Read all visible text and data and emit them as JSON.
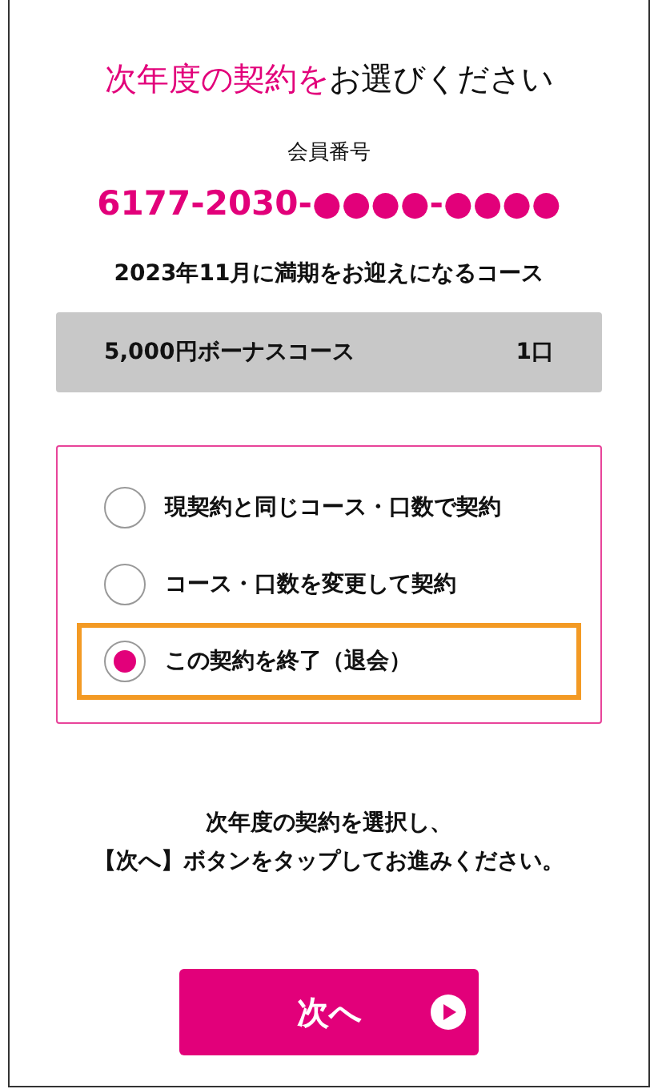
{
  "title": {
    "highlight": "次年度の契約を",
    "rest": "お選びください"
  },
  "member": {
    "label": "会員番号",
    "number": "6177-2030-●●●●-●●●●"
  },
  "course_heading": "2023年11月に満期をお迎えになるコース",
  "course": {
    "name": "5,000円ボーナスコース",
    "units": "1口"
  },
  "options": [
    {
      "label": "現契約と同じコース・口数で契約",
      "selected": false
    },
    {
      "label": "コース・口数を変更して契約",
      "selected": false
    },
    {
      "label": "この契約を終了（退会）",
      "selected": true
    }
  ],
  "instructions": [
    "次年度の契約を選択し、",
    "【次へ】ボタンをタップしてお進みください。"
  ],
  "next_button": {
    "label": "次へ"
  }
}
